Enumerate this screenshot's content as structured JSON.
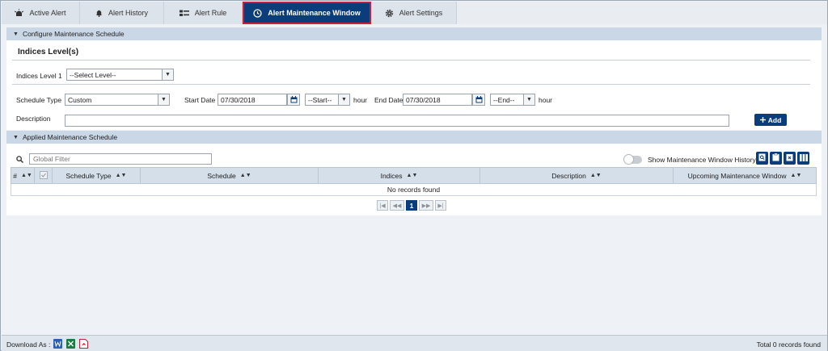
{
  "tabs": [
    {
      "label": "Active Alert",
      "icon": "alarm-icon"
    },
    {
      "label": "Alert History",
      "icon": "bell-icon"
    },
    {
      "label": "Alert Rule",
      "icon": "rule-list-icon"
    },
    {
      "label": "Alert Maintenance Window",
      "icon": "maintenance-clock-icon",
      "active": true
    },
    {
      "label": "Alert Settings",
      "icon": "gear-icon"
    }
  ],
  "configure": {
    "section_title": "Configure Maintenance Schedule",
    "heading": "Indices Level(s)",
    "indices_level_label": "Indices Level 1",
    "indices_level_value": "--Select Level--",
    "schedule_type_label": "Schedule Type",
    "schedule_type_value": "Custom",
    "start_date_label": "Start Date",
    "start_date_value": "07/30/2018",
    "start_hour_value": "--Start--",
    "hour_label": "hour",
    "end_date_label": "End Date",
    "end_date_value": "07/30/2018",
    "end_hour_value": "--End--",
    "description_label": "Description",
    "description_value": "",
    "add_label": "Add"
  },
  "applied": {
    "section_title": "Applied Maintenance Schedule",
    "filter_placeholder": "Global Filter",
    "history_toggle_label": "Show Maintenance Window History",
    "history_toggle_on": false,
    "columns": [
      "#",
      "",
      "Schedule Type",
      "Schedule",
      "Indices",
      "Description",
      "Upcoming Maintenance Window"
    ],
    "empty_message": "No records found",
    "current_page": "1"
  },
  "footer": {
    "download_label": "Download As :",
    "formats": [
      "word-icon",
      "excel-icon",
      "pdf-icon"
    ],
    "total_label": "Total 0 records found"
  },
  "colors": {
    "accent": "#0b3d7a",
    "active_tab_border": "#c8203a",
    "section_header": "#c9d7e6",
    "table_header": "#d4dfea"
  }
}
